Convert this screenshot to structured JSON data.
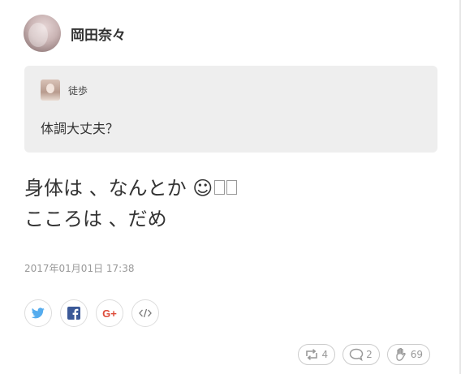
{
  "author": {
    "name": "岡田奈々",
    "avatar": "avatar-photo"
  },
  "quote": {
    "author": "徒歩",
    "avatar": "quote-avatar-photo",
    "text": "体調大丈夫？"
  },
  "post": {
    "line1": "身体は 、なんとか ☺",
    "line2": "こころは 、だめ",
    "timestamp": "2017年01月01日 17:38"
  },
  "share": {
    "buttons": [
      "twitter-icon",
      "facebook-icon",
      "google-plus-icon",
      "embed-code-icon"
    ],
    "google_plus_label": "G+"
  },
  "stats": {
    "reposts": "4",
    "comments": "2",
    "likes": "69"
  },
  "colors": {
    "twitter": "#55acee",
    "facebook": "#3b5998",
    "google_plus": "#dd4b39",
    "quote_bg": "#eeeeee",
    "muted": "#999999"
  }
}
